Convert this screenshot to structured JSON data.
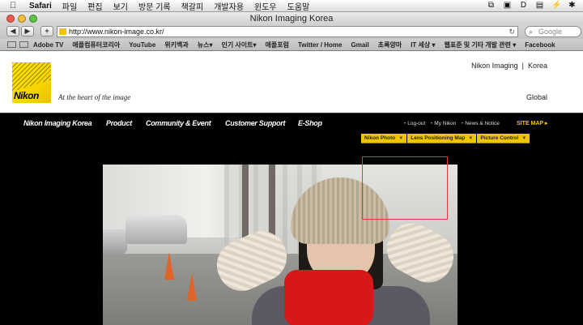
{
  "menubar": {
    "app": "Safari",
    "items": [
      "파일",
      "편집",
      "보기",
      "방문 기록",
      "책갈피",
      "개발자용",
      "윈도우",
      "도움말"
    ]
  },
  "window": {
    "title": "Nikon Imaging Korea"
  },
  "toolbar": {
    "url": "http://www.nikon-image.co.kr/",
    "search_placeholder": "Google"
  },
  "bookmarks": [
    "Adobe TV",
    "애플컴퓨터코리아",
    "YouTube",
    "위키백과",
    "뉴스▾",
    "인기 사이트▾",
    "애플포럼",
    "Twitter / Home",
    "Gmail",
    "초록양마",
    "IT 세상 ▾",
    "웹표준 및 기타 개발 관련 ▾",
    "Facebook"
  ],
  "site": {
    "logo_text": "Nikon",
    "tagline": "At the heart of the image",
    "header_right_1": "Nikon Imaging",
    "header_right_2": "Korea",
    "global": "Global",
    "nav": [
      "Nikon Imaging Korea",
      "Product",
      "Community & Event",
      "Customer Support",
      "E-Shop"
    ],
    "util": [
      "Log-out",
      "My Nikon",
      "News & Notice"
    ],
    "sitemap": "SITE MAP ▸",
    "subtabs": [
      "Nikon Photo",
      "Lens Positioning Map",
      "Picture Control"
    ]
  },
  "colors": {
    "accent": "#f2c400",
    "highlight": "#e2383f",
    "nav_bg": "#000000"
  },
  "icons": [
    "apple-icon",
    "back-icon",
    "forward-icon",
    "add-bookmark-icon",
    "reload-icon",
    "search-icon"
  ]
}
